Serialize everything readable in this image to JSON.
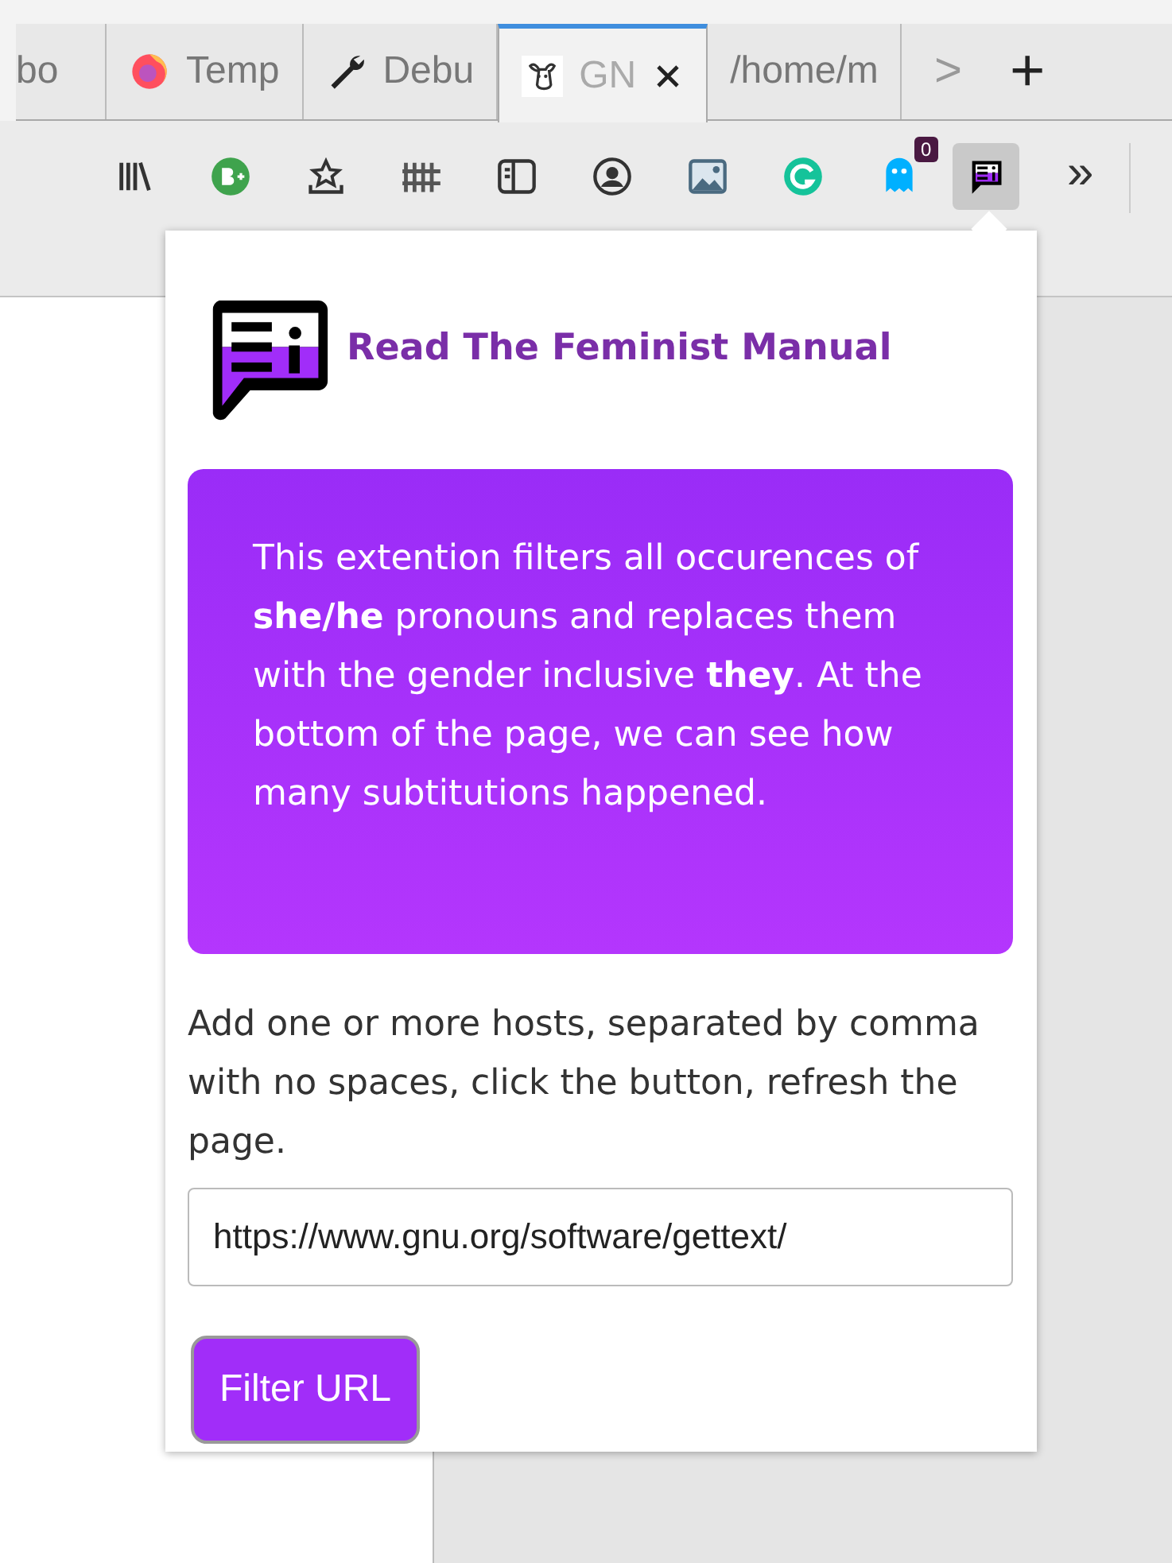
{
  "tabs": [
    {
      "label": "bo",
      "selected": false
    },
    {
      "label": "Temp",
      "selected": false
    },
    {
      "label": "Debu",
      "selected": false
    },
    {
      "label": "GN",
      "selected": true
    },
    {
      "label": "/home/m",
      "selected": false
    }
  ],
  "tab_controls": {
    "scroll": ">",
    "new_tab": "+"
  },
  "toolbar": {
    "badge": "0",
    "extension_pressed": true,
    "overflow": "»"
  },
  "popup": {
    "title": "Read The Feminist Manual",
    "info": "This extention filters all occurences of **she/he** pronouns and replaces them with the gender inclusive **they**. At the bottom of the page, we can see how many subtitutions happened.",
    "instructions": "Add one or more hosts, separated by comma with no spaces, click the button, refresh the page.",
    "url_value": "https://www.gnu.org/software/gettext/",
    "button": "Filter URL"
  }
}
